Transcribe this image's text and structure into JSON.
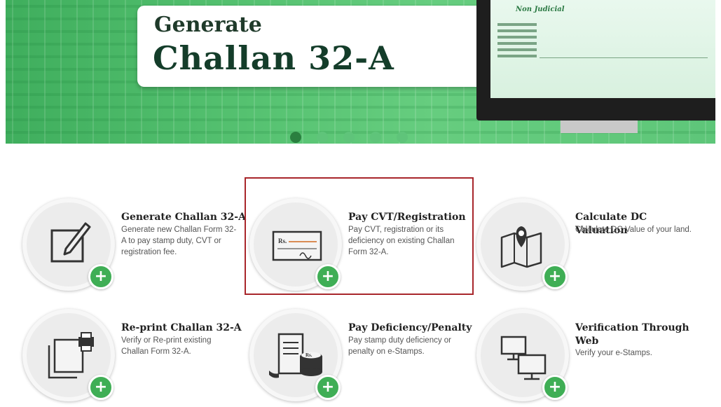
{
  "banner": {
    "line1": "Generate",
    "line2": "Challan 32-A",
    "monitor_doc_title": "Non Judicial",
    "slides_count": 5,
    "active_slide": 1
  },
  "services": [
    {
      "title": "Generate Challan 32-A",
      "description": "Generate new Challan Form 32-A to pay stamp duty, CVT or registration fee.",
      "icon": "edit-document-icon"
    },
    {
      "title": "Pay CVT/Registration",
      "description": "Pay CVT, registration or its deficiency on existing Challan Form 32-A.",
      "icon": "cheque-icon"
    },
    {
      "title": "Calculate DC Valuation",
      "description": "Calculate DC Value of your land.",
      "icon": "map-pin-icon"
    },
    {
      "title": "Re-print Challan 32-A",
      "description": "Verify or Re-print existing Challan Form 32-A.",
      "icon": "printer-icon"
    },
    {
      "title": "Pay Deficiency/Penalty",
      "description": "Pay stamp duty deficiency or penalty on e-Stamps.",
      "icon": "receipt-coins-icon"
    },
    {
      "title": "Verification Through Web",
      "description": "Verify your e-Stamps.",
      "icon": "computers-icon"
    }
  ],
  "plus_symbol": "+",
  "colors": {
    "accent": "#3fae55",
    "highlight": "#a8262b",
    "banner": "#56c271"
  }
}
